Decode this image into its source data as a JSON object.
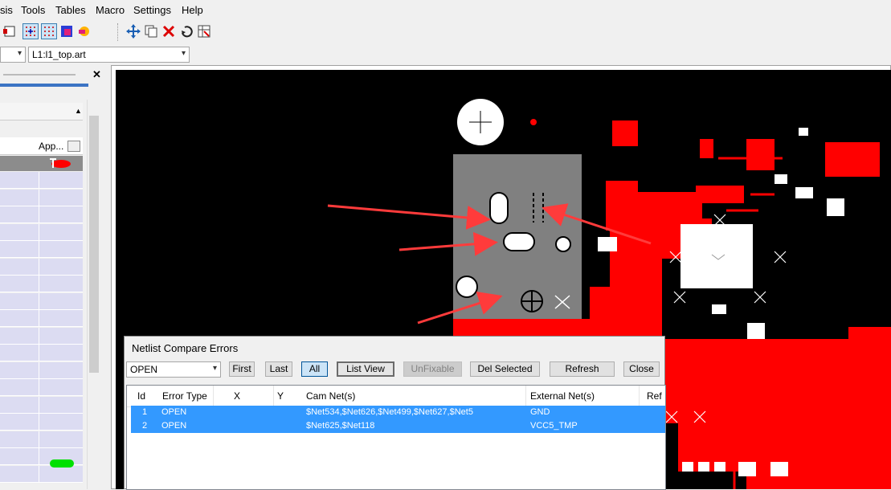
{
  "menu": {
    "items": [
      {
        "label": "sis"
      },
      {
        "label": "Tools"
      },
      {
        "label": "Tables"
      },
      {
        "label": "Macro"
      },
      {
        "label": "Settings"
      },
      {
        "label": "Help"
      }
    ]
  },
  "toolbar": {
    "icons": [
      "layer-icon",
      "grid-snap-icon",
      "grid-icon",
      "color-icon",
      "highlight-icon",
      "move-icon",
      "copy-icon",
      "delete-icon",
      "undo-icon",
      "properties-icon"
    ]
  },
  "layer_row": {
    "layer_value": "L1:l1_top.art"
  },
  "left_panel": {
    "column_header": "App...",
    "close_label": "✕"
  },
  "dialog": {
    "title": "Netlist Compare Errors",
    "filter_value": "OPEN",
    "buttons": {
      "first": "First",
      "last": "Last",
      "all": "All",
      "list_view": "List View",
      "unfixable": "UnFixable",
      "del_selected": "Del Selected",
      "refresh": "Refresh",
      "close": "Close"
    },
    "columns": [
      "Id",
      "Error Type",
      "X",
      "Y",
      "Cam Net(s)",
      "External Net(s)",
      "Ref D"
    ],
    "rows": [
      {
        "id": "1",
        "error_type": "OPEN",
        "x": "",
        "y": "",
        "cam_nets": "$Net534,$Net626,$Net499,$Net627,$Net5",
        "external_net": "GND"
      },
      {
        "id": "2",
        "error_type": "OPEN",
        "x": "",
        "y": "",
        "cam_nets": "$Net625,$Net118",
        "external_net": "VCC5_TMP"
      }
    ]
  },
  "colors": {
    "pcb_background": "#000000",
    "copper": "#ff0000",
    "selected_region": "#808080",
    "selection_row": "#3399ff",
    "annotation_arrow": "#ff3b3b"
  }
}
